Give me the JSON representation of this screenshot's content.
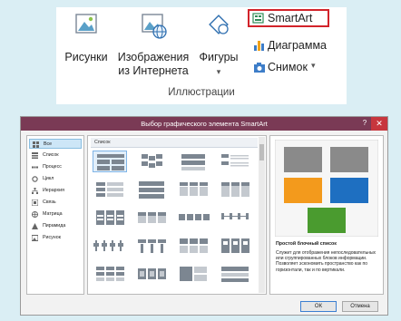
{
  "ribbon": {
    "pictures_label": "Рисунки",
    "online_pictures_label": "Изображения из Интернета",
    "shapes_label": "Фигуры",
    "smartart_label": "SmartArt",
    "chart_label": "Диаграмма",
    "screenshot_label": "Снимок",
    "group_label": "Иллюстрации",
    "dropdown_glyph": "▾"
  },
  "dialog": {
    "title": "Выбор графического элемента SmartArt",
    "help_glyph": "?",
    "close_glyph": "✕",
    "categories": [
      {
        "label": "Все",
        "icon": "all-icon"
      },
      {
        "label": "Список",
        "icon": "list-icon"
      },
      {
        "label": "Процесс",
        "icon": "process-icon"
      },
      {
        "label": "Цикл",
        "icon": "cycle-icon"
      },
      {
        "label": "Иерархия",
        "icon": "hierarchy-icon"
      },
      {
        "label": "Связь",
        "icon": "relationship-icon"
      },
      {
        "label": "Матрица",
        "icon": "matrix-icon"
      },
      {
        "label": "Пирамида",
        "icon": "pyramid-icon"
      },
      {
        "label": "Рисунок",
        "icon": "picture-icon"
      }
    ],
    "list_header": "Список",
    "preview_title": "Простой блочный список",
    "preview_description": "Служит для отображения непоследовательных или сгруппированных блоков информации. Позволяет эскономить пространство как по горизонтали, так и по вертикали.",
    "ok_label": "ОК",
    "cancel_label": "Отмена",
    "colors": {
      "gray": "#8a8a8a",
      "orange": "#f39a1c",
      "blue": "#1e6fc1",
      "green": "#4a9b2f"
    }
  }
}
